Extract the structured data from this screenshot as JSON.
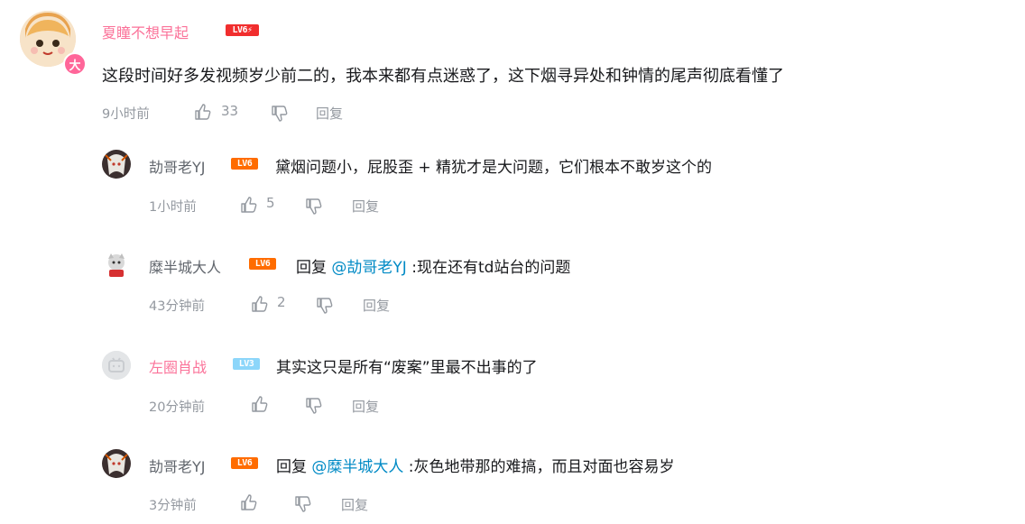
{
  "colors": {
    "accent_pink": "#fb7299",
    "link_blue": "#008ac5",
    "meta_gray": "#9499a0"
  },
  "main_comment": {
    "username": "夏瞳不想早起",
    "level": "LV6⚡",
    "badge": "大",
    "text": "这段时间好多发视频岁少前二的，我本来都有点迷惑了，这下烟寻异处和钟情的尾声彻底看懂了",
    "time": "9小时前",
    "likes": "33",
    "reply_label": "回复"
  },
  "replies": [
    {
      "username": "劼哥老YJ",
      "level": "LV6",
      "prefix": "",
      "mention": "",
      "text": "黛烟问题小，屁股歪 + 精犹才是大问题，它们根本不敢岁这个的",
      "time": "1小时前",
      "likes": "5",
      "reply_label": "回复"
    },
    {
      "username": "糜半城大人",
      "level": "LV6",
      "prefix": "回复 ",
      "mention": "@劼哥老YJ",
      "text": " :现在还有td站台的问题",
      "time": "43分钟前",
      "likes": "2",
      "reply_label": "回复"
    },
    {
      "username": "左圈肖战",
      "level": "LV3",
      "prefix": "",
      "mention": "",
      "text": "其实这只是所有“废案”里最不出事的了",
      "time": "20分钟前",
      "likes": "",
      "reply_label": "回复"
    },
    {
      "username": "劼哥老YJ",
      "level": "LV6",
      "prefix": "回复 ",
      "mention": "@糜半城大人",
      "text": " :灰色地带那的难搞，而且对面也容易岁",
      "time": "3分钟前",
      "likes": "",
      "reply_label": "回复"
    }
  ]
}
